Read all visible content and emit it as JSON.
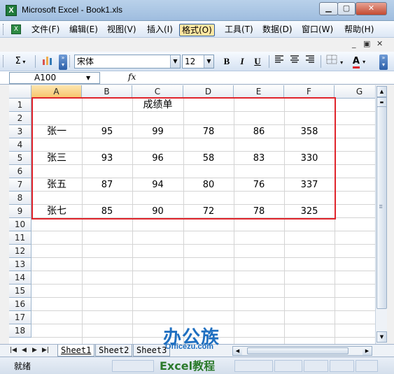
{
  "window": {
    "title": "Microsoft Excel - Book1.xls",
    "icon": "excel-app-icon"
  },
  "menu": {
    "items": [
      "文件(F)",
      "编辑(E)",
      "视图(V)",
      "插入(I)",
      "格式(O)",
      "工具(T)",
      "数据(D)",
      "窗口(W)",
      "帮助(H)"
    ],
    "active_index": 4
  },
  "toolbar": {
    "font": "宋体",
    "size": "12",
    "bold": "B",
    "italic": "I",
    "underline": "U",
    "sum": "Σ"
  },
  "formula_bar": {
    "name_box": "A100",
    "fx": "fx",
    "formula": ""
  },
  "grid": {
    "columns": [
      "A",
      "B",
      "C",
      "D",
      "E",
      "F",
      "G"
    ],
    "rows": [
      "1",
      "2",
      "3",
      "4",
      "5",
      "6",
      "7",
      "8",
      "9",
      "10",
      "11",
      "12",
      "13",
      "14",
      "15",
      "16",
      "17",
      "18"
    ],
    "title": "成绩单",
    "records": [
      {
        "row": "3",
        "name": "张一",
        "b": "95",
        "c": "99",
        "d": "78",
        "e": "86",
        "f": "358"
      },
      {
        "row": "5",
        "name": "张三",
        "b": "93",
        "c": "96",
        "d": "58",
        "e": "83",
        "f": "330"
      },
      {
        "row": "7",
        "name": "张五",
        "b": "87",
        "c": "94",
        "d": "80",
        "e": "76",
        "f": "337"
      },
      {
        "row": "9",
        "name": "张七",
        "b": "85",
        "c": "90",
        "d": "72",
        "e": "78",
        "f": "325"
      }
    ]
  },
  "sheets": {
    "tabs": [
      "Sheet1",
      "Sheet2",
      "Sheet3"
    ],
    "active_index": 0
  },
  "status": {
    "text": "就绪"
  },
  "watermark": {
    "brand": "办公族",
    "url": "Officezu.com",
    "caption": "Excel教程"
  },
  "colors": {
    "highlight": "#e0242b",
    "selected_column": "#f7c46b",
    "title_bar": "#b9d1ea"
  }
}
